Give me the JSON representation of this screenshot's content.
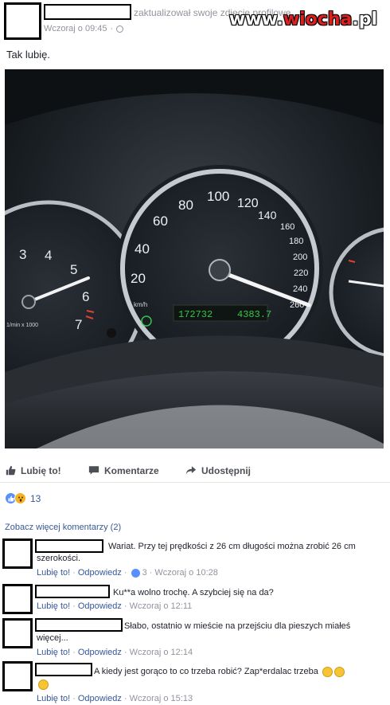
{
  "post": {
    "action_text": "zaktualizował swoje zdjęcie profilowe.",
    "timestamp": "Wczoraj o 09:45",
    "privacy_separator": "·",
    "text": "Tak lubię.",
    "watermark_prefix": "www.",
    "watermark_brand": "wiocha",
    "watermark_suffix": ".pl"
  },
  "photo": {
    "tach_labels": [
      "3",
      "4",
      "5",
      "6",
      "7"
    ],
    "tach_unit": "1/min x 1000",
    "speed_labels": [
      "20",
      "40",
      "60",
      "80",
      "100",
      "120",
      "140",
      "160",
      "180",
      "200",
      "220",
      "240",
      "260"
    ],
    "speed_unit": "km/h",
    "odometer": "172732",
    "trip": "4383.7"
  },
  "actions": {
    "like": "Lubię to!",
    "comment": "Komentarze",
    "share": "Udostępnij"
  },
  "reactions": {
    "count": "13"
  },
  "comments": {
    "see_more": "Zobacz więcej komentarzy (2)",
    "items": [
      {
        "text": "Wariat. Przy tej prędkości z 26 cm długości można zrobić 26 cm szerokości.",
        "like": "Lubię to!",
        "reply": "Odpowiedz",
        "likes": "3",
        "time": "Wczoraj o 10:28"
      },
      {
        "text": "Ku**a wolno trochę. A szybciej się na da?",
        "like": "Lubię to!",
        "reply": "Odpowiedz",
        "time": "Wczoraj o 12:11"
      },
      {
        "text": "Słabo, ostatnio w mieście na przejściu dla pieszych miałeś więcej...",
        "like": "Lubię to!",
        "reply": "Odpowiedz",
        "time": "Wczoraj o 12:14"
      },
      {
        "text": "A kiedy jest gorąco to co trzeba robić? Zap*erdalac trzeba",
        "like": "Lubię to!",
        "reply": "Odpowiedz",
        "time": "Wczoraj o 15:13"
      }
    ],
    "separator": "·"
  },
  "colors": {
    "link": "#365899",
    "meta": "#90949c",
    "like_blue": "#5890ff",
    "wow_yellow": "#f7b125",
    "watermark_red": "#e02020"
  }
}
